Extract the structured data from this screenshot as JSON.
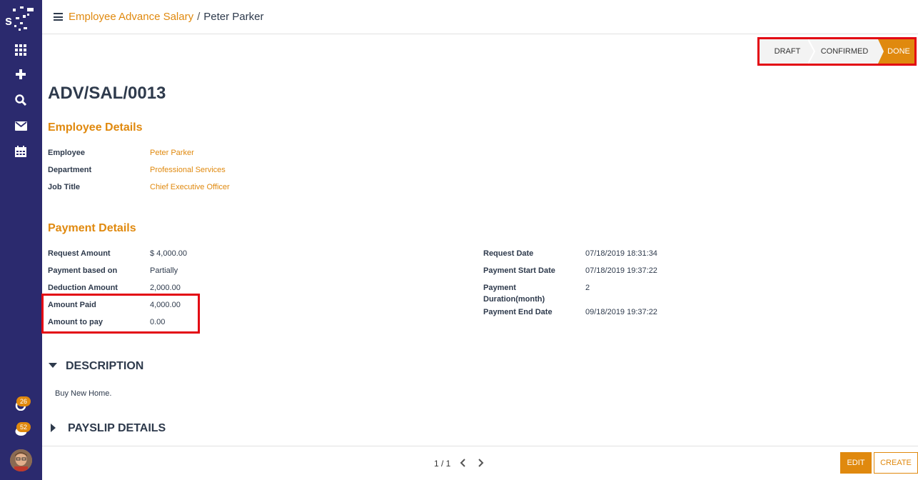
{
  "breadcrumb": {
    "parent": "Employee Advance Salary",
    "separator": "/",
    "current": "Peter Parker"
  },
  "statusbar": {
    "stages": [
      "DRAFT",
      "CONFIRMED",
      "DONE"
    ],
    "active": "DONE"
  },
  "record": {
    "title": "ADV/SAL/0013"
  },
  "employee_details": {
    "heading": "Employee Details",
    "fields": [
      {
        "label": "Employee",
        "value": "Peter Parker"
      },
      {
        "label": "Department",
        "value": "Professional Services"
      },
      {
        "label": "Job Title",
        "value": "Chief Executive Officer"
      }
    ]
  },
  "payment_details": {
    "heading": "Payment Details",
    "left": [
      {
        "label": "Request Amount",
        "value": "$ 4,000.00"
      },
      {
        "label": "Payment based on",
        "value": "Partially"
      },
      {
        "label": "Deduction Amount",
        "value": "2,000.00"
      },
      {
        "label": "Amount Paid",
        "value": "4,000.00"
      },
      {
        "label": "Amount to pay",
        "value": "0.00"
      }
    ],
    "right": [
      {
        "label": "Request Date",
        "value": "07/18/2019 18:31:34"
      },
      {
        "label": "Payment Start Date",
        "value": "07/18/2019 19:37:22"
      },
      {
        "label": "Payment Duration(month)",
        "value": "2"
      },
      {
        "label": "Payment End Date",
        "value": "09/18/2019 19:37:22"
      }
    ]
  },
  "description": {
    "heading": "DESCRIPTION",
    "text": "Buy New Home."
  },
  "payslip": {
    "heading": "PAYSLIP DETAILS"
  },
  "sidebar": {
    "badges": {
      "activity": "26",
      "messages": "52"
    },
    "icons": [
      "apps-icon",
      "plus-icon",
      "search-icon",
      "mail-icon",
      "calendar-icon",
      "activity-icon",
      "chat-icon"
    ]
  },
  "footer": {
    "pager": "1 / 1",
    "edit_label": "EDIT",
    "create_label": "CREATE"
  },
  "colors": {
    "accent": "#e0890e",
    "sidebar": "#2b2a6e",
    "highlight": "#e30613"
  }
}
